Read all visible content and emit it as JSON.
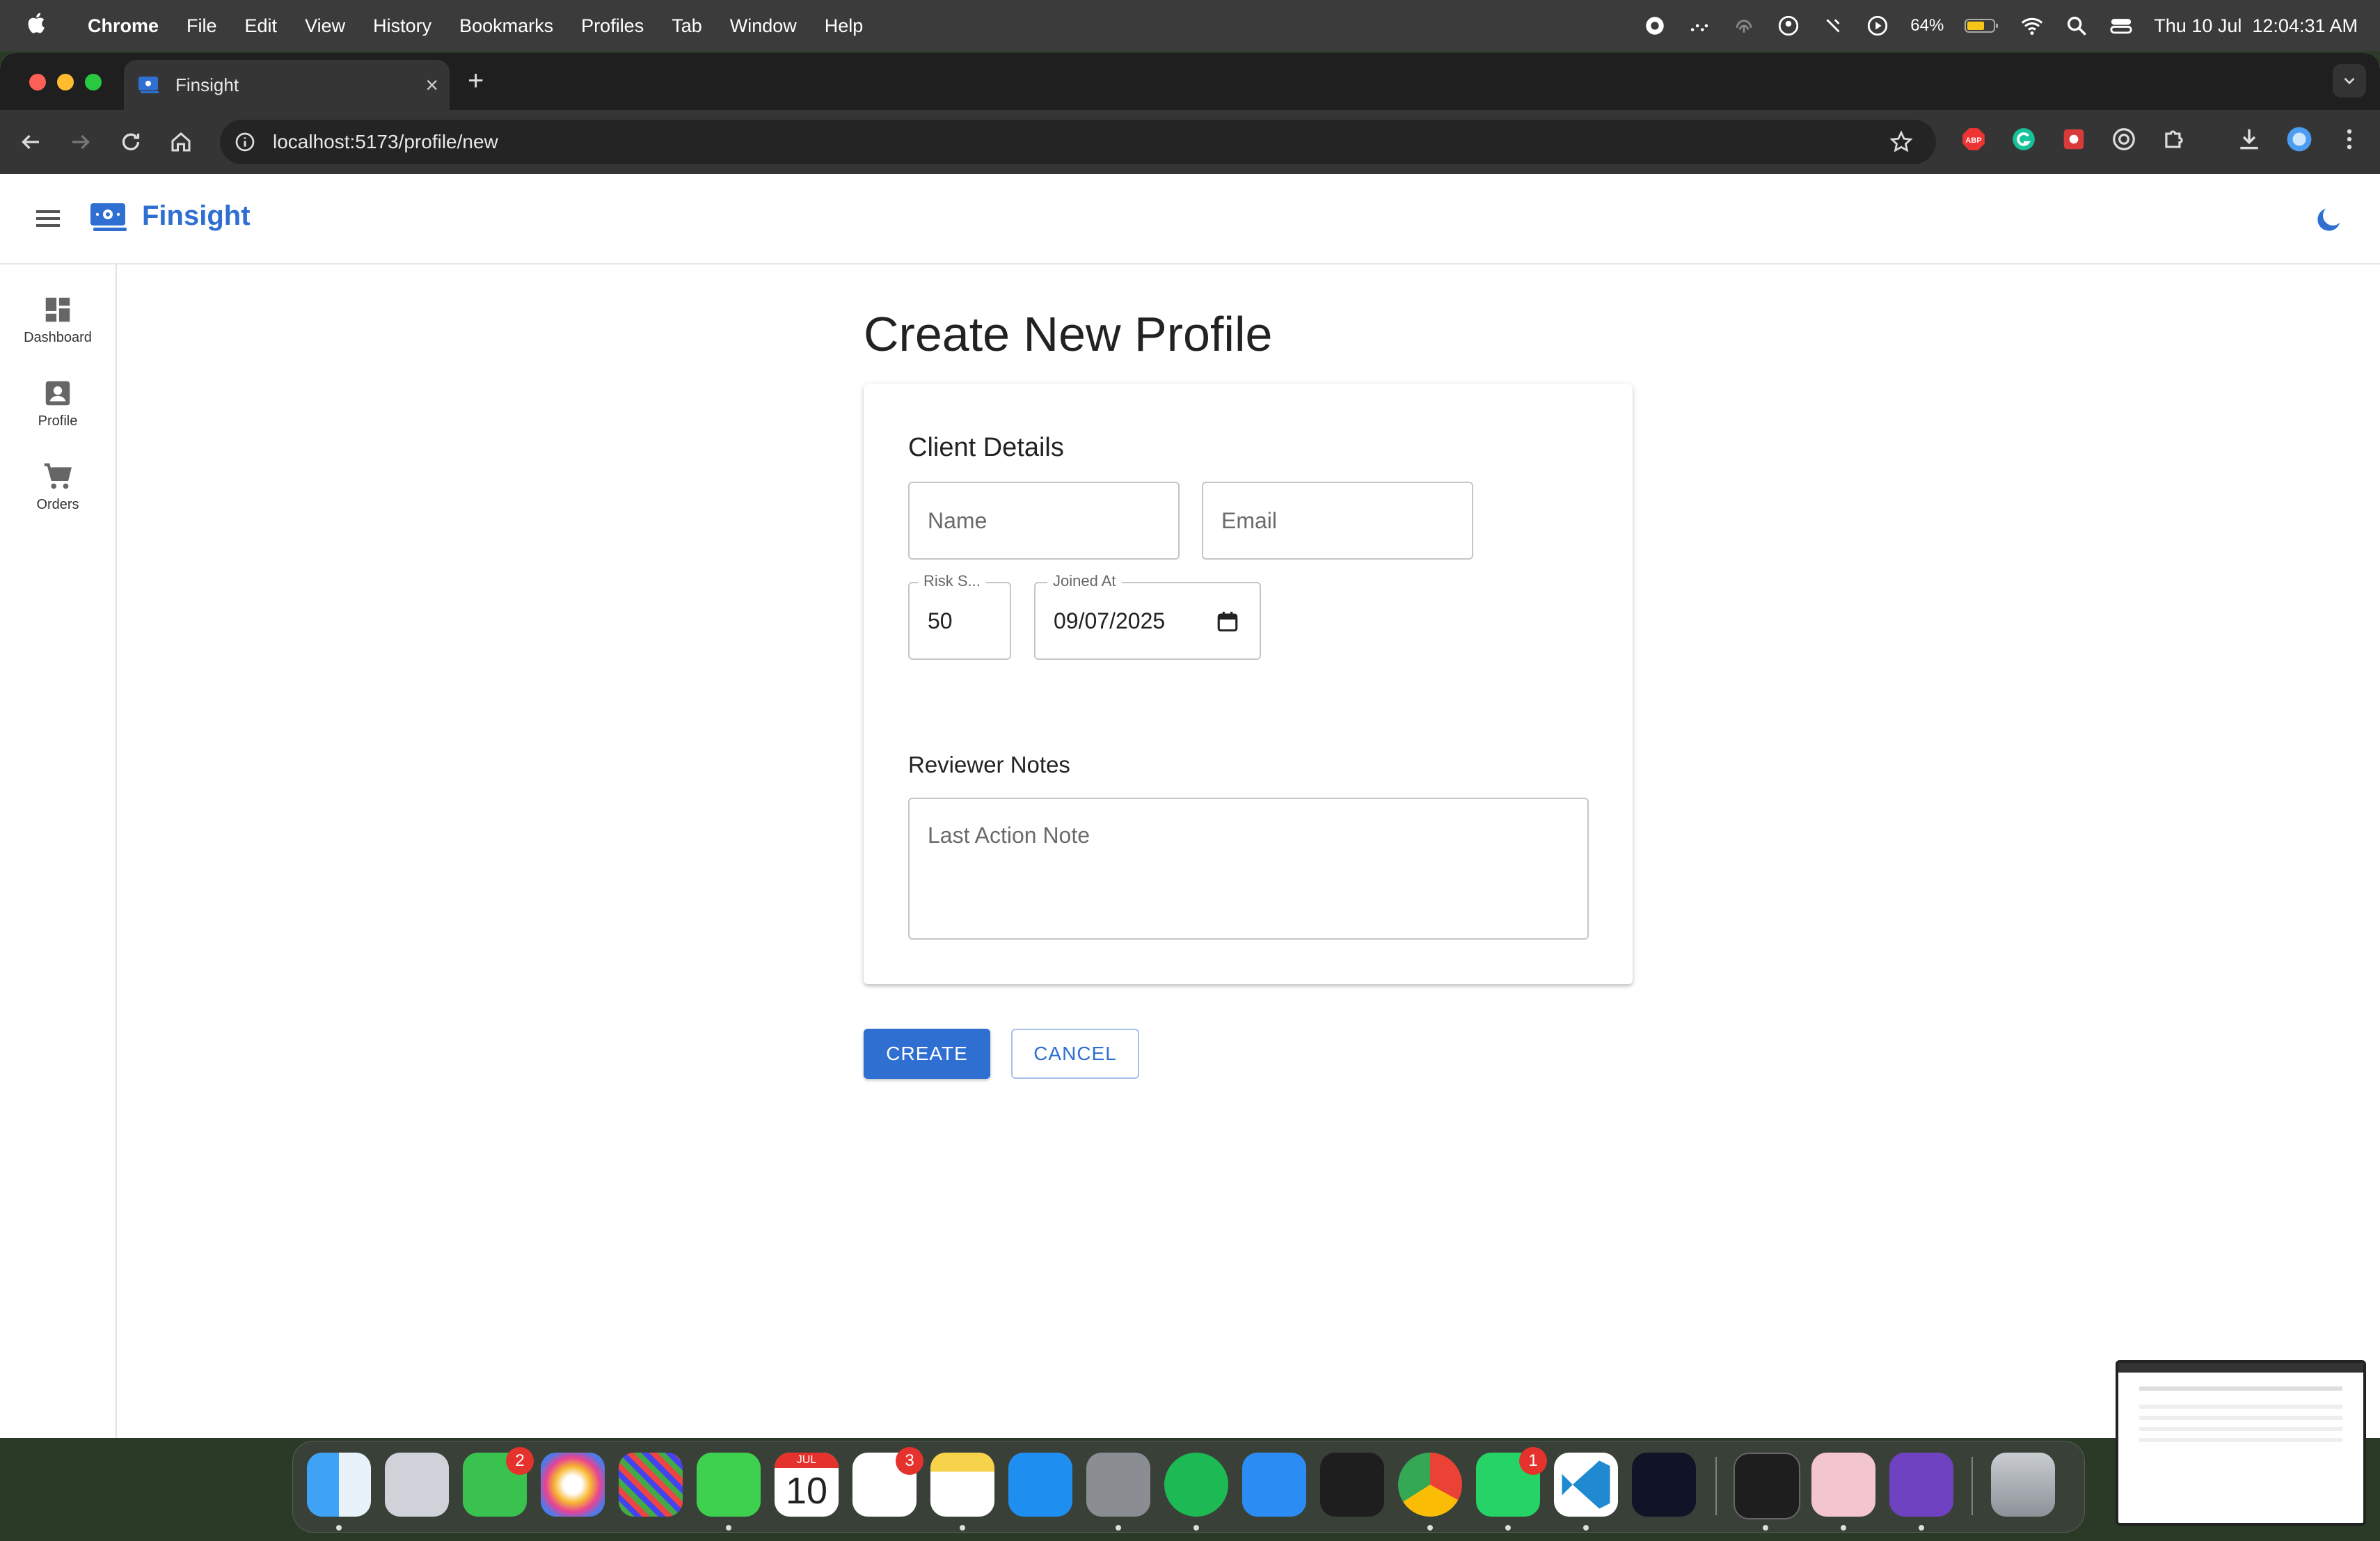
{
  "menubar": {
    "app_name": "Chrome",
    "items": [
      "File",
      "Edit",
      "View",
      "History",
      "Bookmarks",
      "Profiles",
      "Tab",
      "Window",
      "Help"
    ],
    "battery": "64%",
    "clock": "Thu 10 Jul  12:04:31 AM"
  },
  "browser": {
    "tab_title": "Finsight",
    "url": "localhost:5173/profile/new"
  },
  "app": {
    "brand": "Finsight",
    "sidebar": [
      {
        "label": "Dashboard",
        "icon": "dashboard-icon"
      },
      {
        "label": "Profile",
        "icon": "profile-icon"
      },
      {
        "label": "Orders",
        "icon": "cart-icon"
      }
    ]
  },
  "form": {
    "page_title": "Create New Profile",
    "client_details_title": "Client Details",
    "name_placeholder": "Name",
    "email_placeholder": "Email",
    "risk_label": "Risk S...",
    "risk_value": "50",
    "joined_label": "Joined At",
    "joined_value": "09/07/2025",
    "reviewer_notes_title": "Reviewer Notes",
    "note_placeholder": "Last Action Note",
    "create_label": "CREATE",
    "cancel_label": "CANCEL"
  },
  "dock": {
    "calendar_month": "JUL",
    "calendar_day": "10",
    "badges": {
      "facetime": "2",
      "reminders": "3",
      "whatsapp": "1"
    }
  },
  "colors": {
    "accent": "#2f6fd1",
    "menubar": "#3b3b3b",
    "tabbar": "#1f1f1f",
    "toolbar": "#353535"
  }
}
